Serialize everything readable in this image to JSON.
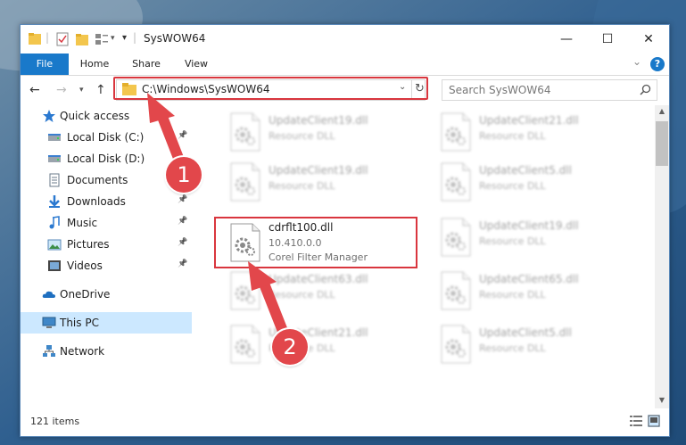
{
  "window": {
    "title": "SysWOW64",
    "controls": {
      "minimize": "—",
      "maximize": "☐",
      "close": "✕"
    }
  },
  "ribbon": {
    "tabs": [
      "File",
      "Home",
      "Share",
      "View"
    ],
    "help": "?",
    "collapse": "⌄"
  },
  "address": {
    "path": "C:\\Windows\\SysWOW64",
    "search_placeholder": "Search SysWOW64"
  },
  "sidebar": {
    "items": [
      {
        "label": "Quick access",
        "icon": "star-icon",
        "pinned": false
      },
      {
        "label": "Local Disk (C:)",
        "icon": "drive-icon",
        "pinned": true
      },
      {
        "label": "Local Disk (D:)",
        "icon": "drive-icon",
        "pinned": false
      },
      {
        "label": "Documents",
        "icon": "documents-icon",
        "pinned": true
      },
      {
        "label": "Downloads",
        "icon": "download-icon",
        "pinned": true
      },
      {
        "label": "Music",
        "icon": "music-icon",
        "pinned": true
      },
      {
        "label": "Pictures",
        "icon": "pictures-icon",
        "pinned": true
      },
      {
        "label": "Videos",
        "icon": "videos-icon",
        "pinned": true
      },
      {
        "label": "OneDrive",
        "icon": "onedrive-icon",
        "pinned": false
      },
      {
        "label": "This PC",
        "icon": "computer-icon",
        "pinned": false,
        "selected": true
      },
      {
        "label": "Network",
        "icon": "network-icon",
        "pinned": false
      }
    ]
  },
  "files": {
    "left": [
      {
        "name": "UpdateClient19.dll",
        "type": "Resource DLL"
      },
      {
        "name": "UpdateClient19.dll",
        "type": "Resource DLL"
      },
      {
        "name": "UpdateClient63.dll",
        "type": "Resource DLL"
      },
      {
        "name": "UpdateClient21.dll",
        "type": "Resource DLL"
      }
    ],
    "right": [
      {
        "name": "UpdateClient21.dll",
        "type": "Resource DLL"
      },
      {
        "name": "UpdateClient5.dll",
        "type": "Resource DLL"
      },
      {
        "name": "UpdateClient19.dll",
        "type": "Resource DLL"
      },
      {
        "name": "UpdateClient65.dll",
        "type": "Resource DLL"
      },
      {
        "name": "UpdateClient5.dll",
        "type": "Resource DLL"
      }
    ],
    "focused": {
      "name": "cdrflt100.dll",
      "version": "10.410.0.0",
      "description": "Corel Filter Manager"
    }
  },
  "status": {
    "item_count": "121 items"
  },
  "callouts": {
    "step1": "1",
    "step2": "2"
  },
  "colors": {
    "accent": "#1979ca",
    "highlight": "#d9363e",
    "selected": "#cce8ff"
  }
}
